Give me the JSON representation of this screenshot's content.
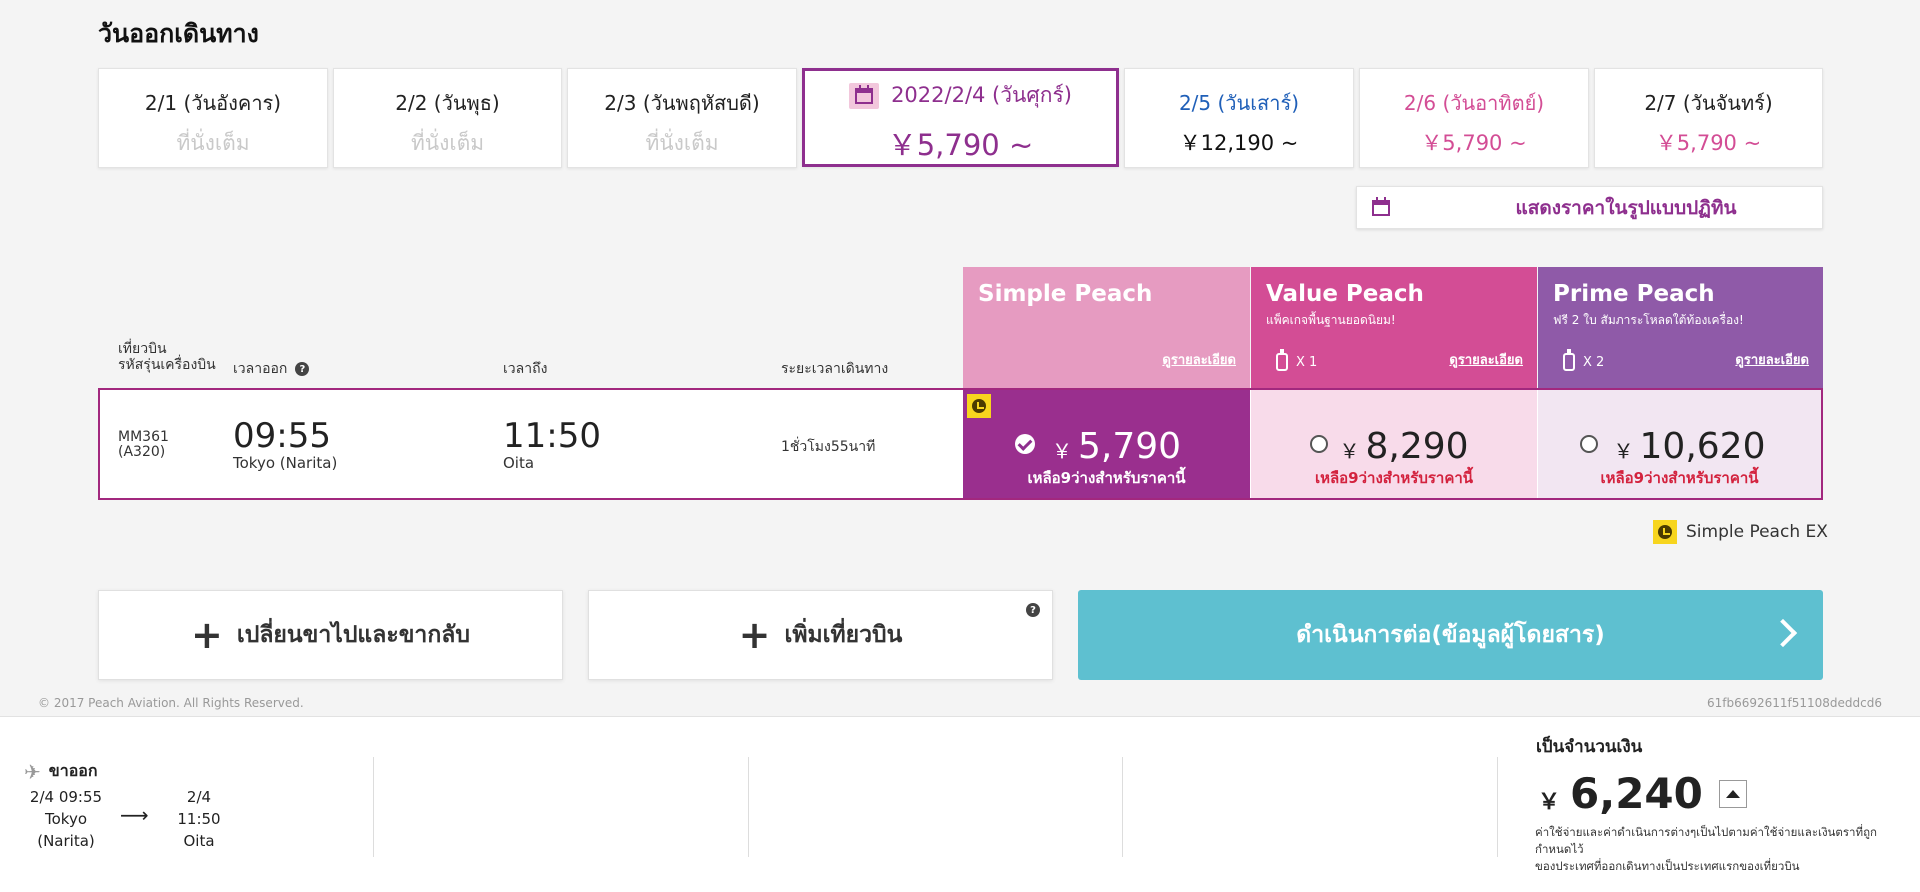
{
  "section": {
    "title": "วันออกเดินทาง"
  },
  "dates": [
    {
      "label": "2/1 (วันอังคาร)",
      "sub": "ที่นั่งเต็ม"
    },
    {
      "label": "2/2 (วันพุธ)",
      "sub": "ที่นั่งเต็ม"
    },
    {
      "label": "2/3 (วันพฤหัสบดี)",
      "sub": "ที่นั่งเต็ม"
    },
    {
      "label": "2022/2/4 (วันศุกร์)",
      "sub": "￥5,790 ~"
    },
    {
      "label": "2/5 (วันเสาร์)",
      "sub": "￥12,190 ~"
    },
    {
      "label": "2/6 (วันอาทิตย์)",
      "sub": "￥5,790 ~"
    },
    {
      "label": "2/7 (วันจันทร์)",
      "sub": "￥5,790 ~"
    }
  ],
  "calendar_button": {
    "label": "แสดงราคาในรูปแบบปฏิทิน"
  },
  "columns": {
    "flight": "เที่ยวบิน",
    "aircraft": "รหัสรุ่นเครื่องบิน",
    "depart": "เวลาออก",
    "arrive": "เวลาถึง",
    "duration": "ระยะเวลาเดินทาง"
  },
  "fares": [
    {
      "name": "Simple Peach",
      "desc": "",
      "bag": "",
      "detail": "ดูรายละเอียด",
      "price": "5,790",
      "seats": "เหลือ9ว่างสำหรับราคานี้"
    },
    {
      "name": "Value Peach",
      "desc": "แพ็คเกจพื้นฐานยอดนิยม!",
      "bag": "X 1",
      "detail": "ดูรายละเอียด",
      "price": "8,290",
      "seats": "เหลือ9ว่างสำหรับราคานี้"
    },
    {
      "name": "Prime Peach",
      "desc": "ฟรี 2 ใบ สัมภาระโหลดใต้ท้องเครื่อง!",
      "bag": "X 2",
      "detail": "ดูรายละเอียด",
      "price": "10,620",
      "seats": "เหลือ9ว่างสำหรับราคานี้"
    }
  ],
  "yen": "￥",
  "flight": {
    "number": "MM361",
    "aircraft": "(A320)",
    "depart_time": "09:55",
    "depart_airport": "Tokyo (Narita)",
    "arrive_time": "11:50",
    "arrive_airport": "Oita",
    "duration": "1ชั่วโมง55นาที"
  },
  "legend": {
    "label": "Simple Peach EX"
  },
  "actions": {
    "change": "เปลี่ยนขาไปและขากลับ",
    "add": "เพิ่มเที่ยวบิน",
    "proceed": "ดำเนินการต่อ(ข้อมูลผู้โดยสาร)"
  },
  "footer": {
    "copyright": "© 2017 Peach Aviation. All Rights Reserved.",
    "hash": "61fb6692611f51108deddcd6"
  },
  "summary": {
    "direction": "ขาออก",
    "depart": "2/4 09:55",
    "depart_city": "Tokyo",
    "depart_airport": "(Narita)",
    "arrive": "2/4 11:50",
    "arrive_city": "Oita",
    "arrow": "⟶",
    "total_label": "เป็นจำนวนเงิน",
    "total": "6,240",
    "note1": "ค่าใช้จ่ายและค่าดำเนินการต่างๆเป็นไปตามค่าใช้จ่ายและเงินตราที่ถูก",
    "note2": "กำหนดไว้",
    "note3": "ของประเทศที่ออกเดินทางเป็นประเทศแรกของเที่ยวบิน"
  }
}
